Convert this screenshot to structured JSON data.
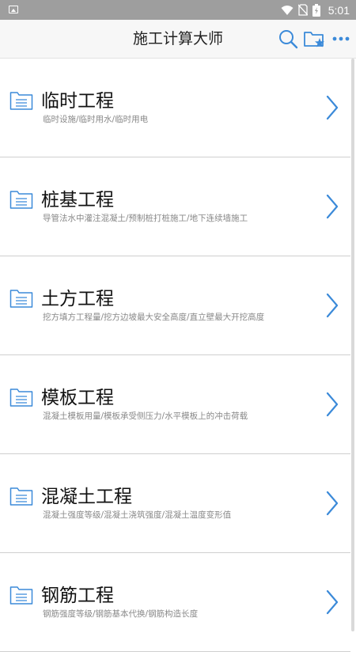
{
  "status_bar": {
    "time": "5:01",
    "icons": [
      "image-icon",
      "wifi-icon",
      "no-sim-icon",
      "battery-charging-icon"
    ]
  },
  "header": {
    "title": "施工计算大师",
    "actions": [
      "search-icon",
      "favorites-folder-icon",
      "more-icon"
    ]
  },
  "colors": {
    "accent": "#3b8ad9",
    "status_bar": "#9e9e9e",
    "header_bg": "#f7f7f7"
  },
  "categories": [
    {
      "title": "临时工程",
      "subtitle": "临时设施/临时用水/临时用电"
    },
    {
      "title": "桩基工程",
      "subtitle": "导管法水中灌注混凝土/预制桩打桩施工/地下连续墙施工"
    },
    {
      "title": "土方工程",
      "subtitle": "挖方填方工程量/挖方边坡最大安全高度/直立壁最大开挖高度"
    },
    {
      "title": "模板工程",
      "subtitle": "混凝土模板用量/模板承受侧压力/水平模板上的冲击荷载"
    },
    {
      "title": "混凝土工程",
      "subtitle": "混凝土强度等级/混凝土浇筑强度/混凝土温度变形值"
    },
    {
      "title": "钢筋工程",
      "subtitle": "钢筋强度等级/钢筋基本代换/钢筋构造长度"
    }
  ]
}
